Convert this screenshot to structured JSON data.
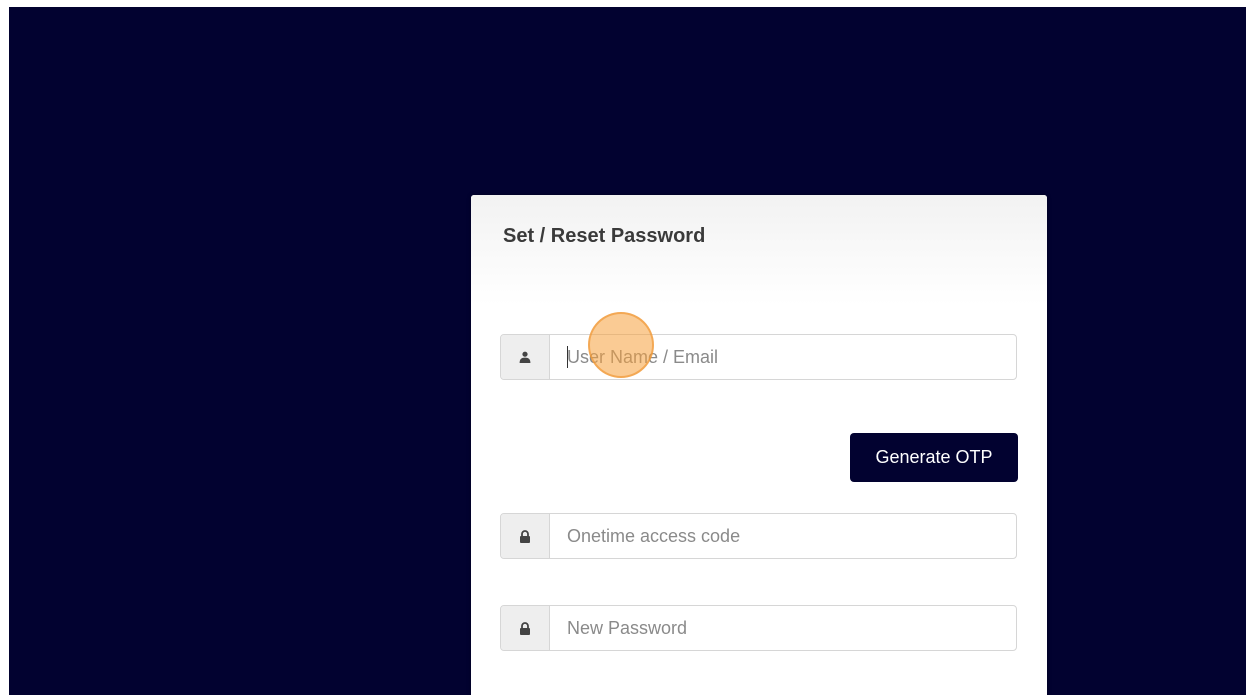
{
  "page": {
    "background_color": "#020230",
    "accent_color": "#020230"
  },
  "form": {
    "title": "Set / Reset Password",
    "username": {
      "icon": "user-icon",
      "placeholder": "User Name / Email",
      "value": ""
    },
    "generate_otp_label": "Generate OTP",
    "otp": {
      "icon": "lock-icon",
      "placeholder": "Onetime access code",
      "value": ""
    },
    "new_password": {
      "icon": "lock-icon",
      "placeholder": "New Password",
      "value": ""
    }
  }
}
